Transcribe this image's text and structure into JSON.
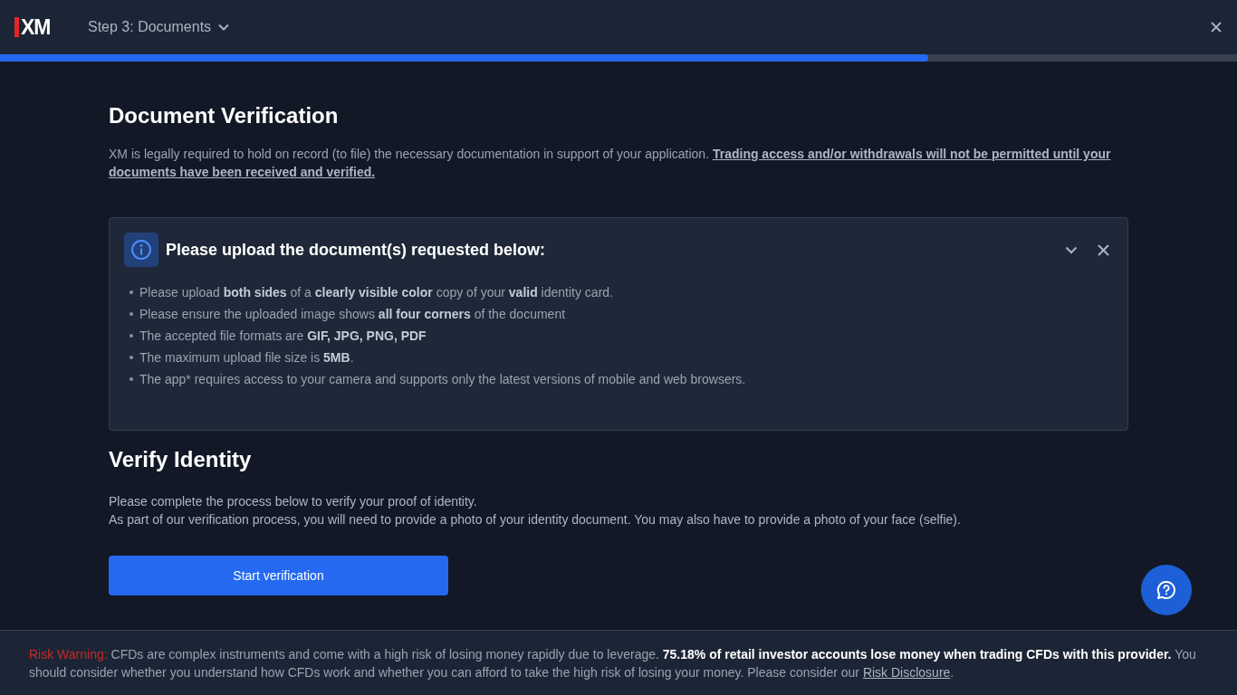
{
  "header": {
    "logo": "XM",
    "step": "Step 3: Documents",
    "progress": {
      "level": 0.75
    }
  },
  "verification": {
    "title": "Document Verification",
    "text": "XM is legally required to hold on record (to file) the necessary documentation in support of your application. ",
    "emphasis": "Trading access and/or withdrawals will not be permitted until your documents have been received and verified."
  },
  "notice": {
    "title": "Please upload the document(s) requested below:",
    "expanded": true,
    "items": [
      "Please upload **both sides** of a **clearly visible color** copy of your **valid** identity card.",
      "Please ensure the uploaded image shows **all four corners** of the document",
      "The accepted file formats are **GIF, JPG, PNG, PDF**",
      "The maximum upload file size is **5MB**.",
      "The app* requires access to your camera and supports only the latest versions of mobile and web browsers."
    ]
  },
  "identity": {
    "title": "Verify Identity",
    "paragraphs": [
      "Please complete the process below to verify your proof of identity.",
      "As part of our verification process, you will need to provide a photo of your identity document. You may also have to provide a photo of your face (selfie)."
    ],
    "button": "Start verification"
  },
  "risk": {
    "label": "Risk Warning:",
    "text": " CFDs are complex instruments and come with a high risk of losing money rapidly due to leverage. **75.18% of retail investor accounts lose money when trading CFDs with this provider.** You should consider whether you understand how CFDs work and whether you can afford to take the high risk of losing your money. Please consider our ",
    "link": "Risk Disclosure",
    "end": "."
  }
}
